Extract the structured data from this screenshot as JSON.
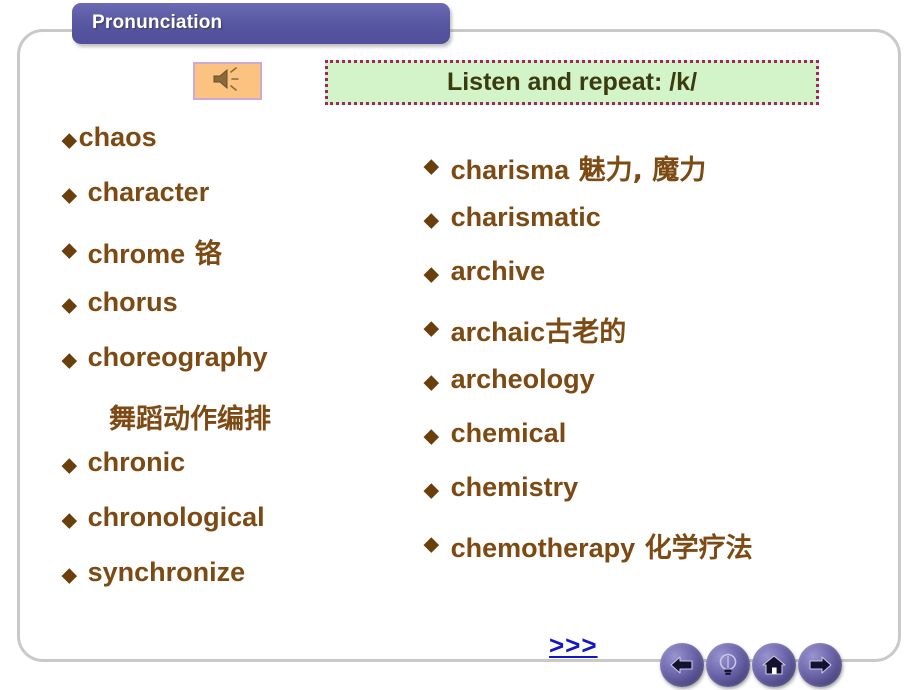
{
  "slide": {
    "title": "Pronunciation",
    "banner": {
      "text": "Listen and repeat: /k/",
      "background_color": "#d3f3c9",
      "border_color": "#a42361",
      "text_color": "#3b3b10"
    },
    "speaker_icon": {
      "name": "speaker-icon",
      "background_color": "#fbc37f",
      "border_color": "#cda8d8"
    },
    "text_color": "#7c4a12",
    "title_bar_color": "#5656a0",
    "frame_color": "#c9c9c9"
  },
  "left_column": {
    "items": [
      {
        "word": "chaos",
        "gloss": "",
        "tight": true
      },
      {
        "word": "character",
        "gloss": ""
      },
      {
        "word": "chrome",
        "gloss": " 铬"
      },
      {
        "word": "chorus",
        "gloss": ""
      },
      {
        "word": "choreography",
        "gloss": ""
      }
    ],
    "note": "舞蹈动作编排",
    "items_after_note": [
      {
        "word": "chronic",
        "gloss": ""
      },
      {
        "word": "chronological",
        "gloss": ""
      },
      {
        "word": "synchronize",
        "gloss": ""
      }
    ]
  },
  "right_column": {
    "items": [
      {
        "word": "charisma",
        "gloss": " 魅力, 魔力"
      },
      {
        "word": "charismatic",
        "gloss": ""
      },
      {
        "word": "archive",
        "gloss": ""
      },
      {
        "word": "archaic",
        "gloss": "古老的"
      },
      {
        "word": "archeology",
        "gloss": ""
      },
      {
        "word": "chemical",
        "gloss": ""
      },
      {
        "word": "chemistry",
        "gloss": ""
      },
      {
        "word": "chemotherapy",
        "gloss": " 化学疗法"
      }
    ]
  },
  "bullet_glyph": "◆",
  "footer": {
    "next_link": ">>>",
    "next_link_color": "#1414c8",
    "nav_buttons": [
      {
        "name": "back-arrow-icon",
        "label": "Back"
      },
      {
        "name": "lightbulb-icon",
        "label": "Hint"
      },
      {
        "name": "home-icon",
        "label": "Home"
      },
      {
        "name": "forward-arrow-icon",
        "label": "Forward"
      }
    ]
  }
}
